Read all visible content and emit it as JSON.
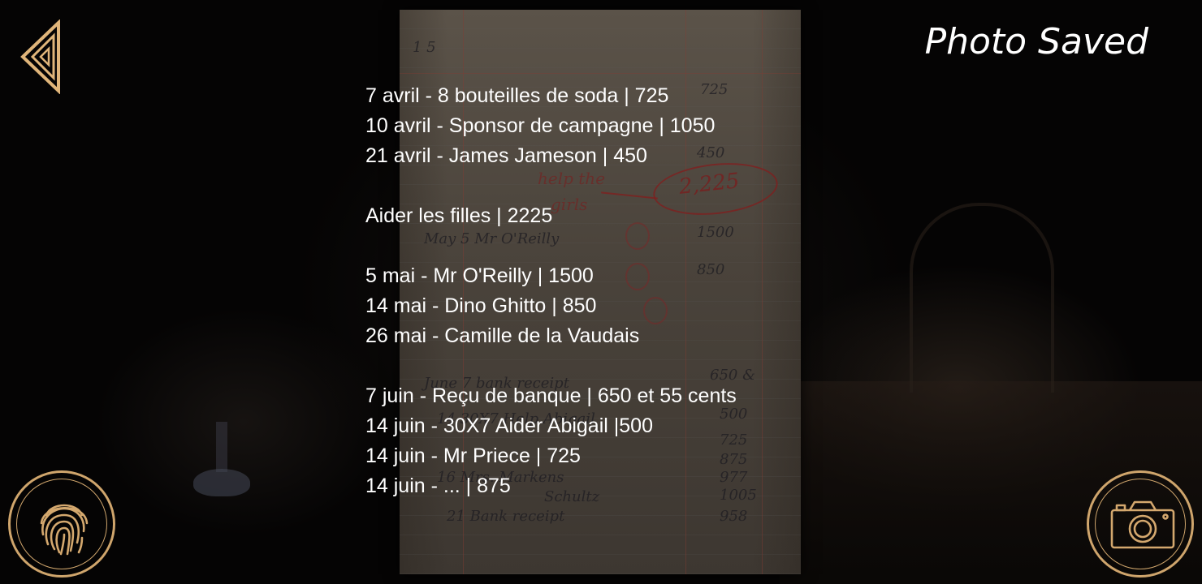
{
  "header": {
    "status_text": "Photo Saved"
  },
  "document": {
    "handwriting": {
      "page_number": "1 5",
      "amounts": [
        "725",
        "450",
        "1500",
        "850",
        "650 &",
        "500",
        "725",
        "875",
        "977",
        "1005",
        "958"
      ],
      "circled_total": "2,225",
      "note_help": "help the",
      "note_girls": "girls",
      "entries": [
        "May 5  Mr O'Reilly",
        "June 7  bank receipt",
        "14  30X7 Help Abigail",
        "16  Mrs. Markens",
        "Schultz",
        "21  Bank receipt"
      ]
    },
    "transcript": {
      "group_april": [
        "7 avril - 8 bouteilles de soda | 725",
        "10 avril - Sponsor de campagne | 1050",
        "21 avril - James Jameson | 450"
      ],
      "group_note": [
        "Aider les filles | 2225"
      ],
      "group_may": [
        "5 mai - Mr O'Reilly | 1500",
        "14 mai - Dino Ghitto | 850",
        "26 mai - Camille de la Vaudais"
      ],
      "group_june": [
        "7 juin - Reçu de banque | 650 et 55 cents",
        "14 juin - 30X7 Aider Abigail |500",
        "14 juin - Mr Priece | 725",
        "14 juin - ... | 875"
      ]
    }
  },
  "controls": {
    "back_icon": "back-arrow-icon",
    "fingerprint_icon": "fingerprint-icon",
    "camera_icon": "camera-icon",
    "accent_color": "#cfa56c"
  }
}
